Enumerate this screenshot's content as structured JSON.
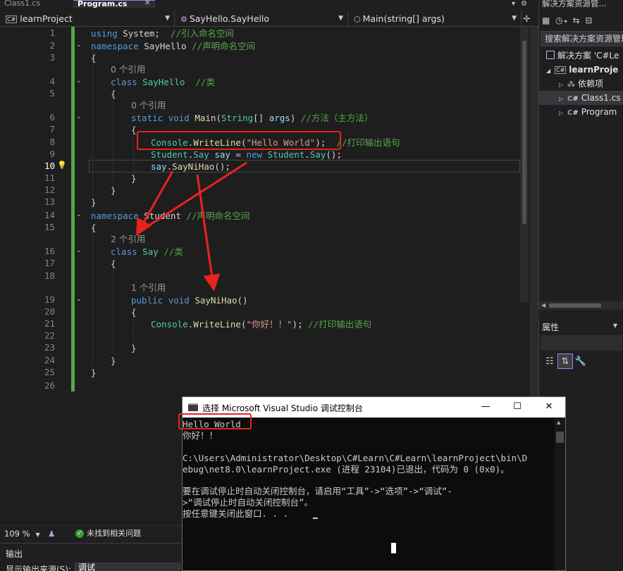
{
  "tabs": [
    {
      "label": "Class1.cs",
      "active": false
    },
    {
      "label": "Program.cs",
      "active": true
    }
  ],
  "tabstrip_icons": [
    "chevron-down-icon",
    "gear-icon"
  ],
  "navbar": {
    "project": "learnProject",
    "class_path": "SayHello.SayHello",
    "member": "Main(string[] args)"
  },
  "editor": {
    "current_line": 10,
    "line_numbers": [
      "1",
      "2",
      "3",
      "4",
      "5",
      "6",
      "7",
      "8",
      "9",
      "10",
      "11",
      "12",
      "13",
      "14",
      "15",
      "16",
      "17",
      "18",
      "19",
      "20",
      "21",
      "22",
      "23",
      "24",
      "25",
      "26"
    ],
    "codelens": {
      "class_sayhello_refs": "0 个引用",
      "main_refs": "0 个引用",
      "class_say_refs": "2 个引用",
      "saynihao_refs": "1 个引用"
    },
    "tokens": {
      "using": "using",
      "system": "System;",
      "c_import": "//引入命名空间",
      "namespace": "namespace",
      "sayhello_ns": "SayHello",
      "c_ns": "//声明命名空间",
      "lbrace": "{",
      "rbrace": "}",
      "class": "class",
      "sayhello_cls": "SayHello",
      "c_class": "//类",
      "static": "static",
      "void": "void",
      "main": "Main",
      "lparen": "(",
      "string_t": "String",
      "arr_args": "[] ",
      "args": "args",
      "rparen_main": ")",
      "c_method": "//方法（主方法）",
      "console": "Console",
      "dot": ".",
      "writeline": "WriteLine",
      "str_hello": "\"Hello World\"",
      "call_end": ");",
      "c_print": "//打印输出语句",
      "student": "Student",
      "say": "Say",
      "say_var": "say",
      "eq": " = ",
      "new": "new",
      "ctor_end": "();",
      "saynihao": "SayNiHao",
      "call_empty": "();",
      "student_ns": "Student",
      "say_cls": "Say",
      "public": "public",
      "parens": "()",
      "str_nihao": "\"你好！！\""
    }
  },
  "zoom": "109 %",
  "issues_status": "未找到相关问题",
  "output_panel": {
    "title": "输出",
    "source_label": "显示输出来源(S):",
    "source_value": "调试"
  },
  "solution_explorer": {
    "title": "解决方案资源管...",
    "search_placeholder": "搜索解决方案资源管理",
    "items": [
      {
        "label": "解决方案 'C#Le"
      },
      {
        "label": "learnProje"
      },
      {
        "label": "依赖项"
      },
      {
        "label": "Class1.cs"
      },
      {
        "label": "Program"
      }
    ]
  },
  "properties": {
    "title": "属性"
  },
  "console": {
    "title": "选择 Microsoft Visual Studio 调试控制台",
    "lines": [
      "Hello World",
      "你好！！",
      "",
      "C:\\Users\\Administrator\\Desktop\\C#Learn\\C#Learn\\learnProject\\bin\\D",
      "ebug\\net8.0\\learnProject.exe (进程 23104)已退出，代码为 0 (0x0)。",
      "",
      "要在调试停止时自动关闭控制台，请启用“工具”->“选项”->“调试”-",
      ">“调试停止时自动关闭控制台”。",
      "按任意键关闭此窗口. . ."
    ]
  },
  "colors": {
    "keyword": "#569cd6",
    "type": "#4ec9b0",
    "method": "#dcdcaa",
    "string": "#d69d85",
    "comment": "#57a64a",
    "annotation": "#e8231f"
  }
}
